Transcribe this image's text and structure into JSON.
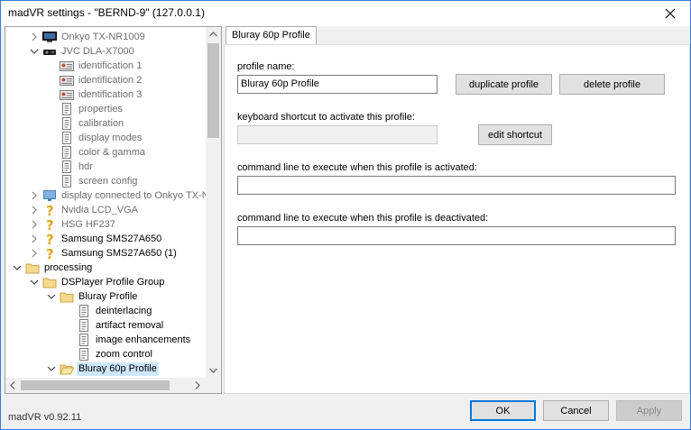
{
  "window": {
    "title": "madVR settings - \"BERND-9\" (127.0.0.1)"
  },
  "tree": [
    {
      "label": "Onkyo TX-NR1009",
      "icon": "tv-icon",
      "level": 2,
      "expander": "collapsed",
      "gray": true
    },
    {
      "label": "JVC DLA-X7000",
      "icon": "projector-icon",
      "level": 2,
      "expander": "expanded",
      "gray": true
    },
    {
      "label": "identification 1",
      "icon": "id-card-icon",
      "level": 3,
      "expander": "none",
      "gray": true
    },
    {
      "label": "identification 2",
      "icon": "id-card-icon",
      "level": 3,
      "expander": "none",
      "gray": true
    },
    {
      "label": "identification 3",
      "icon": "id-card-icon",
      "level": 3,
      "expander": "none",
      "gray": true
    },
    {
      "label": "properties",
      "icon": "page-icon",
      "level": 3,
      "expander": "none",
      "gray": true
    },
    {
      "label": "calibration",
      "icon": "page-icon",
      "level": 3,
      "expander": "none",
      "gray": true
    },
    {
      "label": "display modes",
      "icon": "page-icon",
      "level": 3,
      "expander": "none",
      "gray": true
    },
    {
      "label": "color & gamma",
      "icon": "page-icon",
      "level": 3,
      "expander": "none",
      "gray": true
    },
    {
      "label": "hdr",
      "icon": "page-icon",
      "level": 3,
      "expander": "none",
      "gray": true
    },
    {
      "label": "screen config",
      "icon": "page-icon",
      "level": 3,
      "expander": "none",
      "gray": true
    },
    {
      "label": "display connected to Onkyo TX-N",
      "icon": "monitor-icon",
      "level": 2,
      "expander": "collapsed",
      "gray": true
    },
    {
      "label": "Nvidia LCD_VGA",
      "icon": "question-icon",
      "level": 2,
      "expander": "collapsed",
      "gray": true
    },
    {
      "label": "HSG HF237",
      "icon": "question-icon",
      "level": 2,
      "expander": "collapsed",
      "gray": true
    },
    {
      "label": "Samsung SMS27A650",
      "icon": "question-icon",
      "level": 2,
      "expander": "collapsed",
      "gray": false
    },
    {
      "label": "Samsung SMS27A650 (1)",
      "icon": "question-icon",
      "level": 2,
      "expander": "collapsed",
      "gray": false
    },
    {
      "label": "processing",
      "icon": "folder-icon",
      "level": 1,
      "expander": "expanded",
      "gray": false
    },
    {
      "label": "DSPlayer Profile Group",
      "icon": "folder-icon",
      "level": 2,
      "expander": "expanded",
      "gray": false
    },
    {
      "label": "Bluray Profile",
      "icon": "folder-icon",
      "level": 3,
      "expander": "expanded",
      "gray": false
    },
    {
      "label": "deinterlacing",
      "icon": "page-icon",
      "level": 4,
      "expander": "none",
      "gray": false
    },
    {
      "label": "artifact removal",
      "icon": "page-icon",
      "level": 4,
      "expander": "none",
      "gray": false
    },
    {
      "label": "image enhancements",
      "icon": "page-icon",
      "level": 4,
      "expander": "none",
      "gray": false
    },
    {
      "label": "zoom control",
      "icon": "page-icon",
      "level": 4,
      "expander": "none",
      "gray": false
    },
    {
      "label": "Bluray 60p Profile",
      "icon": "folder-open-icon",
      "level": 3,
      "expander": "expanded",
      "gray": false,
      "selected": true
    }
  ],
  "tab": {
    "label": "Bluray 60p Profile"
  },
  "profile": {
    "name_label": "profile name:",
    "name_value": "Bluray 60p Profile",
    "duplicate_label": "duplicate profile",
    "delete_label": "delete profile",
    "shortcut_label": "keyboard shortcut to activate this profile:",
    "shortcut_value": "",
    "edit_shortcut_label": "edit shortcut",
    "activate_cmd_label": "command line to execute when this profile is activated:",
    "activate_cmd_value": "",
    "deactivate_cmd_label": "command line to execute when this profile is deactivated:",
    "deactivate_cmd_value": ""
  },
  "footer": {
    "version": "madVR v0.92.11",
    "ok_label": "OK",
    "cancel_label": "Cancel",
    "apply_label": "Apply"
  },
  "colors": {
    "accent": "#0078d7",
    "selection": "#cce8ff",
    "disabled_text": "#8a8a8a"
  }
}
